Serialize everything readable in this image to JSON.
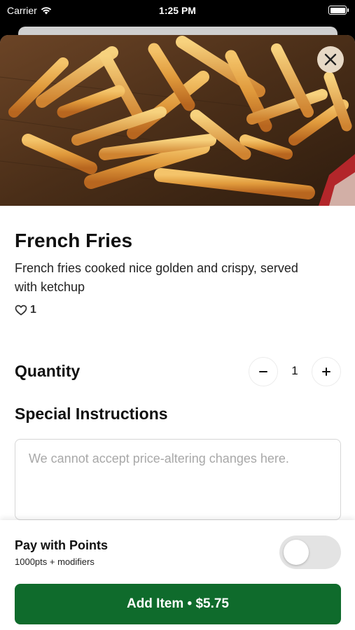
{
  "status_bar": {
    "carrier": "Carrier",
    "time": "1:25 PM"
  },
  "item": {
    "name": "French Fries",
    "description": "French fries cooked nice golden and crispy, served with ketchup",
    "like_count": "1",
    "image_icon": "french-fries-photo"
  },
  "quantity": {
    "label": "Quantity",
    "value": "1",
    "decrement_symbol": "−",
    "increment_symbol": "+"
  },
  "special_instructions": {
    "label": "Special Instructions",
    "placeholder": "We cannot accept price-altering changes here.",
    "value": ""
  },
  "pay_with_points": {
    "title": "Pay with Points",
    "subtitle": "1000pts + modifiers",
    "enabled": false
  },
  "add_button": {
    "label": "Add Item • $5.75"
  },
  "colors": {
    "primary_green": "#0f6b2c",
    "toggle_off": "#e3e3e3",
    "close_bg": "#f5e8d6"
  }
}
